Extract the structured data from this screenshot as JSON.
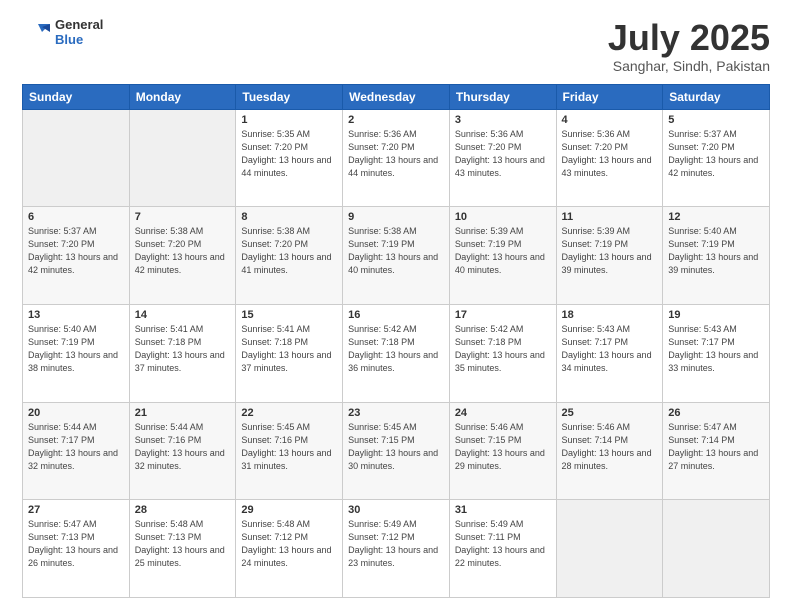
{
  "header": {
    "logo_general": "General",
    "logo_blue": "Blue",
    "month_title": "July 2025",
    "location": "Sanghar, Sindh, Pakistan"
  },
  "calendar": {
    "headers": [
      "Sunday",
      "Monday",
      "Tuesday",
      "Wednesday",
      "Thursday",
      "Friday",
      "Saturday"
    ],
    "weeks": [
      [
        {
          "day": "",
          "info": ""
        },
        {
          "day": "",
          "info": ""
        },
        {
          "day": "1",
          "info": "Sunrise: 5:35 AM\nSunset: 7:20 PM\nDaylight: 13 hours and 44 minutes."
        },
        {
          "day": "2",
          "info": "Sunrise: 5:36 AM\nSunset: 7:20 PM\nDaylight: 13 hours and 44 minutes."
        },
        {
          "day": "3",
          "info": "Sunrise: 5:36 AM\nSunset: 7:20 PM\nDaylight: 13 hours and 43 minutes."
        },
        {
          "day": "4",
          "info": "Sunrise: 5:36 AM\nSunset: 7:20 PM\nDaylight: 13 hours and 43 minutes."
        },
        {
          "day": "5",
          "info": "Sunrise: 5:37 AM\nSunset: 7:20 PM\nDaylight: 13 hours and 42 minutes."
        }
      ],
      [
        {
          "day": "6",
          "info": "Sunrise: 5:37 AM\nSunset: 7:20 PM\nDaylight: 13 hours and 42 minutes."
        },
        {
          "day": "7",
          "info": "Sunrise: 5:38 AM\nSunset: 7:20 PM\nDaylight: 13 hours and 42 minutes."
        },
        {
          "day": "8",
          "info": "Sunrise: 5:38 AM\nSunset: 7:20 PM\nDaylight: 13 hours and 41 minutes."
        },
        {
          "day": "9",
          "info": "Sunrise: 5:38 AM\nSunset: 7:19 PM\nDaylight: 13 hours and 40 minutes."
        },
        {
          "day": "10",
          "info": "Sunrise: 5:39 AM\nSunset: 7:19 PM\nDaylight: 13 hours and 40 minutes."
        },
        {
          "day": "11",
          "info": "Sunrise: 5:39 AM\nSunset: 7:19 PM\nDaylight: 13 hours and 39 minutes."
        },
        {
          "day": "12",
          "info": "Sunrise: 5:40 AM\nSunset: 7:19 PM\nDaylight: 13 hours and 39 minutes."
        }
      ],
      [
        {
          "day": "13",
          "info": "Sunrise: 5:40 AM\nSunset: 7:19 PM\nDaylight: 13 hours and 38 minutes."
        },
        {
          "day": "14",
          "info": "Sunrise: 5:41 AM\nSunset: 7:18 PM\nDaylight: 13 hours and 37 minutes."
        },
        {
          "day": "15",
          "info": "Sunrise: 5:41 AM\nSunset: 7:18 PM\nDaylight: 13 hours and 37 minutes."
        },
        {
          "day": "16",
          "info": "Sunrise: 5:42 AM\nSunset: 7:18 PM\nDaylight: 13 hours and 36 minutes."
        },
        {
          "day": "17",
          "info": "Sunrise: 5:42 AM\nSunset: 7:18 PM\nDaylight: 13 hours and 35 minutes."
        },
        {
          "day": "18",
          "info": "Sunrise: 5:43 AM\nSunset: 7:17 PM\nDaylight: 13 hours and 34 minutes."
        },
        {
          "day": "19",
          "info": "Sunrise: 5:43 AM\nSunset: 7:17 PM\nDaylight: 13 hours and 33 minutes."
        }
      ],
      [
        {
          "day": "20",
          "info": "Sunrise: 5:44 AM\nSunset: 7:17 PM\nDaylight: 13 hours and 32 minutes."
        },
        {
          "day": "21",
          "info": "Sunrise: 5:44 AM\nSunset: 7:16 PM\nDaylight: 13 hours and 32 minutes."
        },
        {
          "day": "22",
          "info": "Sunrise: 5:45 AM\nSunset: 7:16 PM\nDaylight: 13 hours and 31 minutes."
        },
        {
          "day": "23",
          "info": "Sunrise: 5:45 AM\nSunset: 7:15 PM\nDaylight: 13 hours and 30 minutes."
        },
        {
          "day": "24",
          "info": "Sunrise: 5:46 AM\nSunset: 7:15 PM\nDaylight: 13 hours and 29 minutes."
        },
        {
          "day": "25",
          "info": "Sunrise: 5:46 AM\nSunset: 7:14 PM\nDaylight: 13 hours and 28 minutes."
        },
        {
          "day": "26",
          "info": "Sunrise: 5:47 AM\nSunset: 7:14 PM\nDaylight: 13 hours and 27 minutes."
        }
      ],
      [
        {
          "day": "27",
          "info": "Sunrise: 5:47 AM\nSunset: 7:13 PM\nDaylight: 13 hours and 26 minutes."
        },
        {
          "day": "28",
          "info": "Sunrise: 5:48 AM\nSunset: 7:13 PM\nDaylight: 13 hours and 25 minutes."
        },
        {
          "day": "29",
          "info": "Sunrise: 5:48 AM\nSunset: 7:12 PM\nDaylight: 13 hours and 24 minutes."
        },
        {
          "day": "30",
          "info": "Sunrise: 5:49 AM\nSunset: 7:12 PM\nDaylight: 13 hours and 23 minutes."
        },
        {
          "day": "31",
          "info": "Sunrise: 5:49 AM\nSunset: 7:11 PM\nDaylight: 13 hours and 22 minutes."
        },
        {
          "day": "",
          "info": ""
        },
        {
          "day": "",
          "info": ""
        }
      ]
    ]
  }
}
